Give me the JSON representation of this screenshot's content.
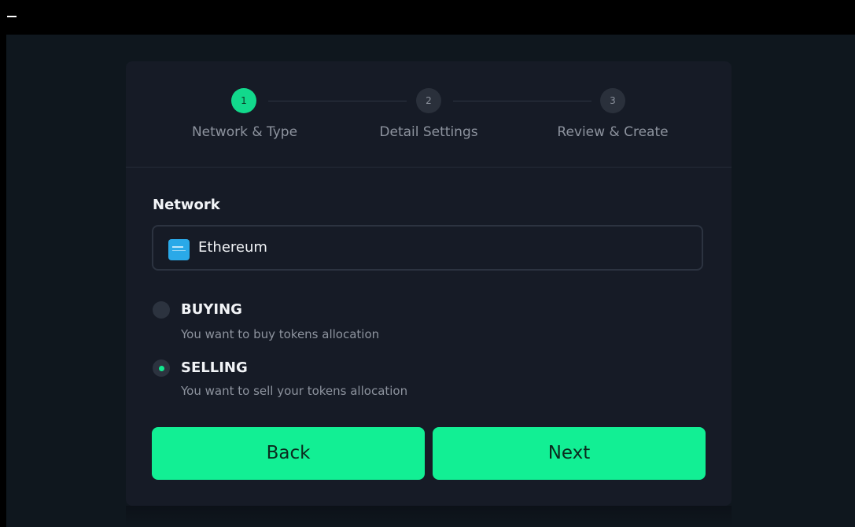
{
  "window": {
    "minimize_glyph": "–"
  },
  "stepper": {
    "steps": [
      {
        "number": "1",
        "label": "Network & Type",
        "state": "active"
      },
      {
        "number": "2",
        "label": "Detail Settings",
        "state": "inactive"
      },
      {
        "number": "3",
        "label": "Review & Create",
        "state": "inactive"
      }
    ]
  },
  "form": {
    "network_label": "Network",
    "network_value": "Ethereum",
    "network_icon": "ethereum-logo-icon",
    "options": [
      {
        "title": "BUYING",
        "description": "You want to buy tokens allocation",
        "checked": false
      },
      {
        "title": "SELLING",
        "description": "You want to sell your tokens allocation",
        "checked": true
      }
    ]
  },
  "actions": {
    "back_label": "Back",
    "next_label": "Next"
  },
  "colors": {
    "accent": "#12ef94",
    "card_bg": "#161b26",
    "page_bg": "#0f171e",
    "muted_text": "#8d939e"
  }
}
